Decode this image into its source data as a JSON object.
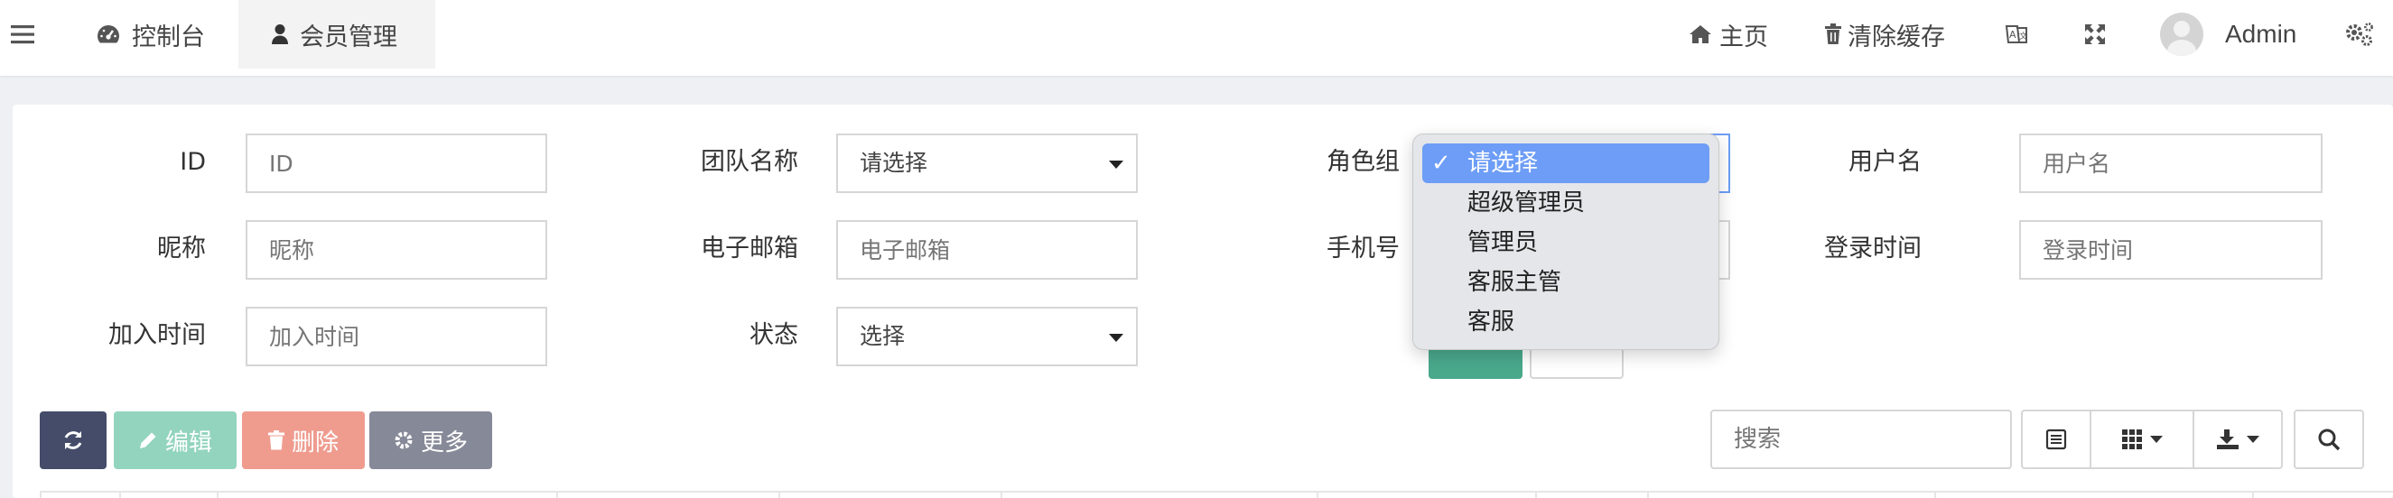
{
  "nav": {
    "tabs": [
      {
        "label": "控制台",
        "icon": "dashboard-icon"
      },
      {
        "label": "会员管理",
        "icon": "user-icon"
      }
    ],
    "home_label": "主页",
    "clear_cache_label": "清除缓存",
    "user_name": "Admin"
  },
  "filters": {
    "id": {
      "label": "ID",
      "placeholder": "ID"
    },
    "team": {
      "label": "团队名称",
      "value": "请选择"
    },
    "role": {
      "label": "角色组"
    },
    "username": {
      "label": "用户名",
      "placeholder": "用户名"
    },
    "nickname": {
      "label": "昵称",
      "placeholder": "昵称"
    },
    "email": {
      "label": "电子邮箱",
      "placeholder": "电子邮箱"
    },
    "phone": {
      "label": "手机号"
    },
    "login_time": {
      "label": "登录时间",
      "placeholder": "登录时间"
    },
    "join_time": {
      "label": "加入时间",
      "placeholder": "加入时间"
    },
    "status": {
      "label": "状态",
      "value": "选择"
    }
  },
  "role_dropdown": {
    "options": [
      "请选择",
      "超级管理员",
      "管理员",
      "客服主管",
      "客服"
    ],
    "selected": "请选择",
    "check_glyph": "✓"
  },
  "toolbar": {
    "edit_label": "编辑",
    "delete_label": "删除",
    "more_label": "更多",
    "search_placeholder": "搜索"
  },
  "colors": {
    "refresh_button": "#444c69",
    "edit_button": "#93d4be",
    "delete_button": "#ef9c8f",
    "more_button": "#868997",
    "dropdown_selected": "#6d9df6"
  }
}
